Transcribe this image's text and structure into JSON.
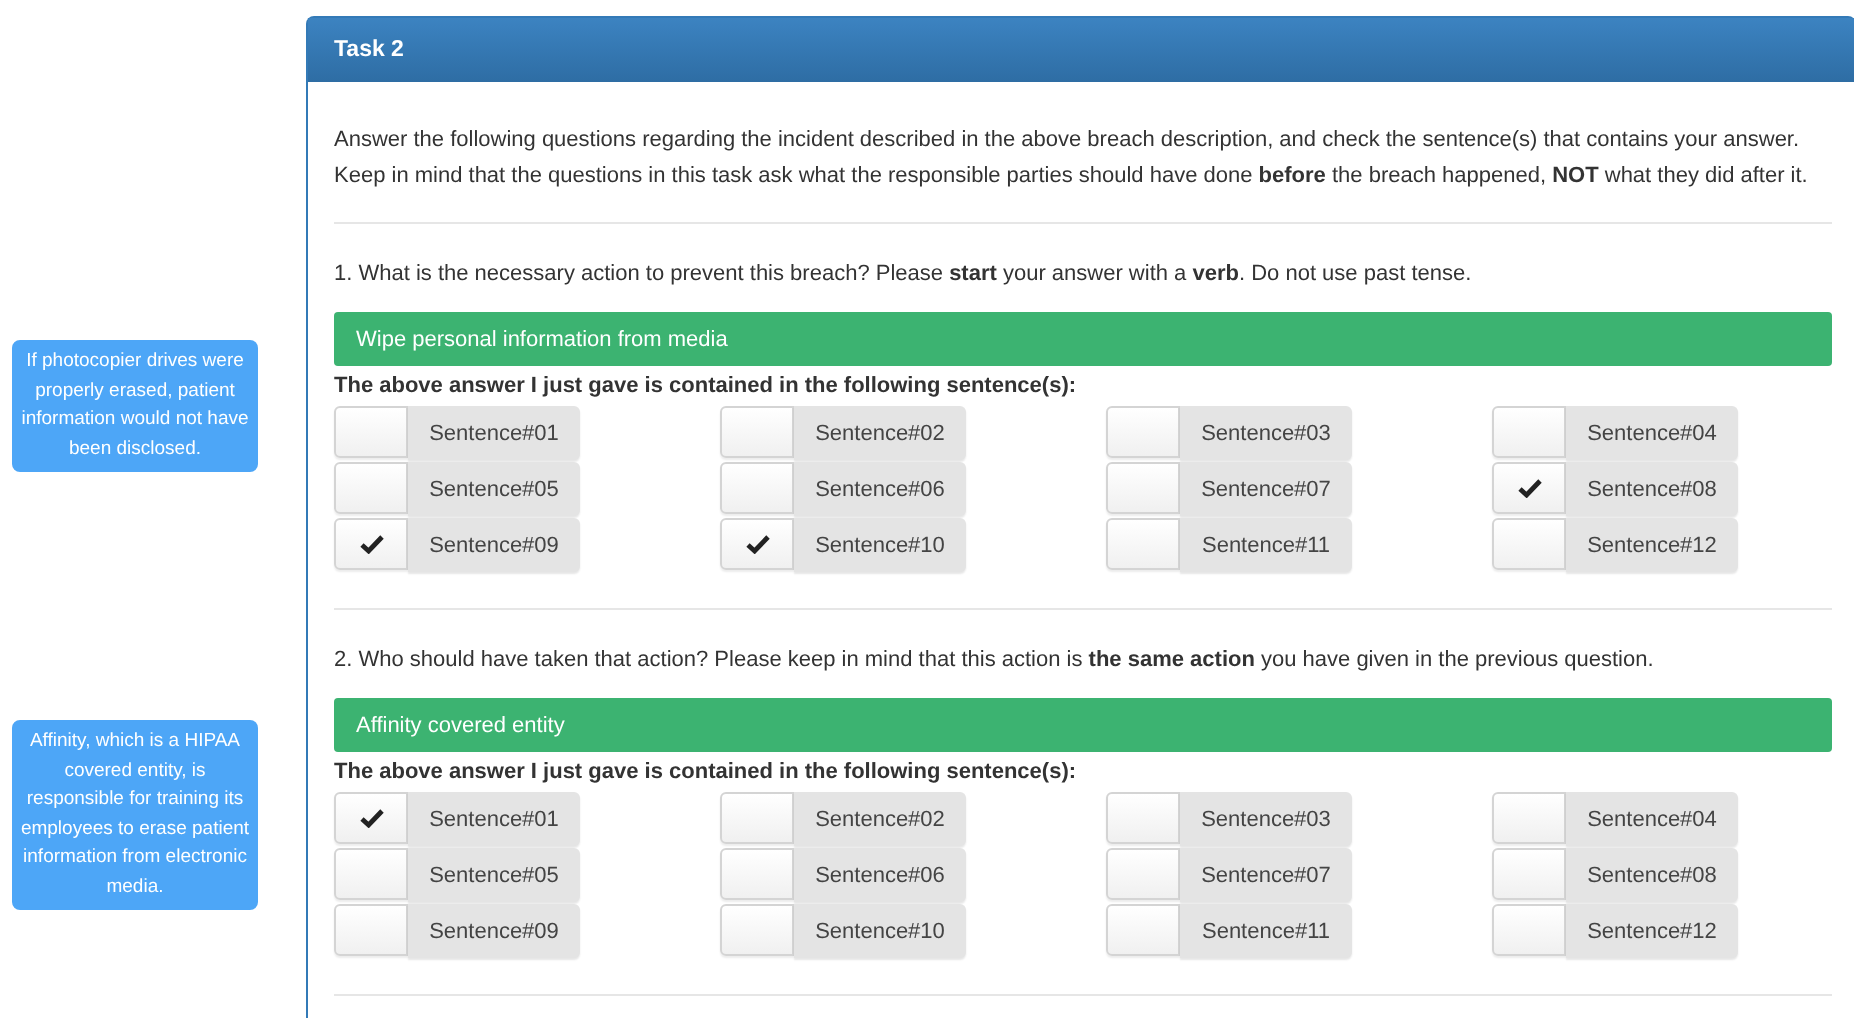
{
  "panel": {
    "title": "Task 2",
    "intro": "Answer the following questions regarding the incident described in the above breach description, and check the sentence(s) that contains your answer. Keep in mind that the questions in this task ask what the responsible parties should have done **before** the breach happened, **NOT** what they did after it."
  },
  "questions": [
    {
      "note": "If photocopier drives were properly erased, patient information would not have been disclosed.",
      "prompt": "1. What is the necessary action to prevent this breach? Please **start** your answer with a **verb**. Do not use past tense.",
      "answer": "Wipe personal information from media",
      "sentences_label": "The above answer I just gave is contained in the following sentence(s):",
      "sentences": [
        {
          "label": "Sentence#01",
          "checked": false
        },
        {
          "label": "Sentence#02",
          "checked": false
        },
        {
          "label": "Sentence#03",
          "checked": false
        },
        {
          "label": "Sentence#04",
          "checked": false
        },
        {
          "label": "Sentence#05",
          "checked": false
        },
        {
          "label": "Sentence#06",
          "checked": false
        },
        {
          "label": "Sentence#07",
          "checked": false
        },
        {
          "label": "Sentence#08",
          "checked": true
        },
        {
          "label": "Sentence#09",
          "checked": true
        },
        {
          "label": "Sentence#10",
          "checked": true
        },
        {
          "label": "Sentence#11",
          "checked": false
        },
        {
          "label": "Sentence#12",
          "checked": false
        }
      ]
    },
    {
      "note": "Affinity, which is a HIPAA covered entity, is responsible for training its employees to erase patient information from electronic media.",
      "prompt": "2. Who should have taken that action? Please keep in mind that this action is **the same action** you have given in the previous question.",
      "answer": "Affinity covered entity",
      "sentences_label": "The above answer I just gave is contained in the following sentence(s):",
      "sentences": [
        {
          "label": "Sentence#01",
          "checked": true
        },
        {
          "label": "Sentence#02",
          "checked": false
        },
        {
          "label": "Sentence#03",
          "checked": false
        },
        {
          "label": "Sentence#04",
          "checked": false
        },
        {
          "label": "Sentence#05",
          "checked": false
        },
        {
          "label": "Sentence#06",
          "checked": false
        },
        {
          "label": "Sentence#07",
          "checked": false
        },
        {
          "label": "Sentence#08",
          "checked": false
        },
        {
          "label": "Sentence#09",
          "checked": false
        },
        {
          "label": "Sentence#10",
          "checked": false
        },
        {
          "label": "Sentence#11",
          "checked": false
        },
        {
          "label": "Sentence#12",
          "checked": false
        }
      ]
    }
  ]
}
